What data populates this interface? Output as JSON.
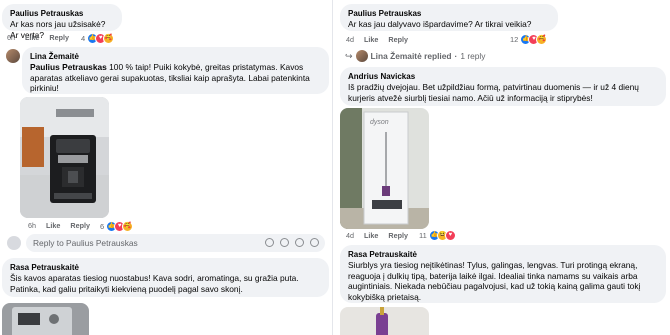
{
  "left": {
    "comment1": {
      "author": "Paulius Petrauskas",
      "text": "Ar kas nors jau užsisakė? Ar verta?",
      "time": "6h",
      "like": "Like",
      "reply": "Reply",
      "reaction_count": "4"
    },
    "comment2": {
      "author": "Lina Žemaitė",
      "mention": "Paulius Petrauskas",
      "text": " 100 % taip! Puiki kokybė, greitas pristatymas. Kavos aparatas atkeliavo gerai supakuotas, tiksliai kaip aprašyta. Labai patenkinta pirkiniu!",
      "time": "6h",
      "like": "Like",
      "reply": "Reply",
      "reaction_count": "6"
    },
    "reply_box": {
      "placeholder": "Reply to Paulius Petrauskas"
    },
    "comment3": {
      "author": "Rasa Petrauskaitė",
      "text": "Šis kavos aparatas tiesiog nuostabus! Kava sodri, aromatinga, su gražia puta. Patinka, kad galiu pritaikyti kiekvieną puodelį pagal savo skonį."
    }
  },
  "right": {
    "comment1": {
      "author": "Paulius Petrauskas",
      "text": "Ar kas jau dalyvavo išpardavime? Ar tikrai veikia?",
      "time": "4d",
      "like": "Like",
      "reply": "Reply",
      "reaction_count": "12"
    },
    "replied": {
      "name": "Lina Žemaitė replied",
      "count": "1 reply"
    },
    "comment2": {
      "author": "Andrius Navickas",
      "text": "Iš pradžių dvejojau. Bet užpildžiau formą, patvirtinau duomenis — ir už 4 dienų kurjeris atvežė siurblį tiesiai namo. Ačiū už informaciją ir stiprybės!",
      "time": "4d",
      "like": "Like",
      "reply": "Reply",
      "reaction_count": "11",
      "photo_brand": "dyson"
    },
    "comment3": {
      "author": "Rasa Petrauskaitė",
      "text": "Siurblys yra tiesiog neįtikėtinas! Tylus, galingas, lengvas. Turi protingą ekraną, reaguoja į dulkių tipą, baterija laikė ilgai. Idealiai tinka namams su vaikais arba augintiniais. Niekada nebūčiau pagalvojusi, kad už tokią kainą galima gauti tokį kokybišką prietaisą."
    }
  }
}
